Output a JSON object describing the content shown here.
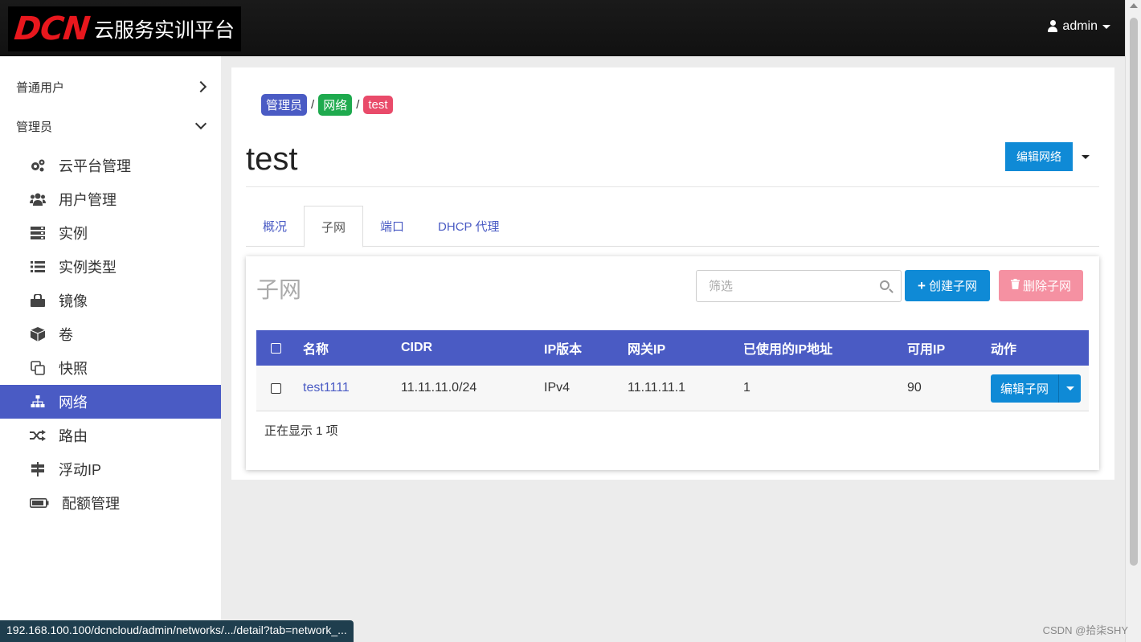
{
  "header": {
    "logo_mark": "DCN",
    "logo_text": "云服务实训平台",
    "user": "admin"
  },
  "sidebar": {
    "groups": [
      {
        "label": "普通用户",
        "state": "collapsed"
      },
      {
        "label": "管理员",
        "state": "expanded"
      }
    ],
    "items": [
      {
        "label": "云平台管理",
        "icon": "cogs-icon"
      },
      {
        "label": "用户管理",
        "icon": "users-icon"
      },
      {
        "label": "实例",
        "icon": "server-icon"
      },
      {
        "label": "实例类型",
        "icon": "list-icon"
      },
      {
        "label": "镜像",
        "icon": "image-icon"
      },
      {
        "label": "卷",
        "icon": "cube-icon"
      },
      {
        "label": "快照",
        "icon": "copy-icon"
      },
      {
        "label": "网络",
        "icon": "sitemap-icon",
        "active": true
      },
      {
        "label": "路由",
        "icon": "random-icon"
      },
      {
        "label": "浮动IP",
        "icon": "signs-icon"
      },
      {
        "label": "配额管理",
        "icon": "battery-icon"
      }
    ]
  },
  "breadcrumb": {
    "items": [
      {
        "label": "管理员",
        "color": "#4a5bc4"
      },
      {
        "label": "网络",
        "color": "#1eaa4e"
      },
      {
        "label": "test",
        "color": "#e94b6a"
      }
    ],
    "separator": "/"
  },
  "page": {
    "title": "test",
    "edit_button": "编辑网络"
  },
  "tabs": [
    {
      "label": "概况"
    },
    {
      "label": "子网",
      "active": true
    },
    {
      "label": "端口"
    },
    {
      "label": "DHCP 代理"
    }
  ],
  "subnets": {
    "title": "子网",
    "filter_placeholder": "筛选",
    "create_button": "创建子网",
    "delete_button": "删除子网",
    "columns": [
      "名称",
      "CIDR",
      "IP版本",
      "网关IP",
      "已使用的IP地址",
      "可用IP",
      "动作"
    ],
    "rows": [
      {
        "name": "test1111",
        "cidr": "11.11.11.0/24",
        "ip_version": "IPv4",
        "gateway": "11.11.11.1",
        "used_ips": "1",
        "available_ips": "90",
        "action": "编辑子网"
      }
    ],
    "count_text": "正在显示 1 项"
  },
  "statusbar": {
    "url": "192.168.100.100/dcncloud/admin/networks/.../detail?tab=network_..."
  },
  "watermark": "CSDN @拾柒SHY",
  "colors": {
    "accent": "#4a5bc4",
    "primary_button": "#0f8ad6",
    "danger_button_disabled": "#f591a2",
    "topbar": "#111111"
  }
}
